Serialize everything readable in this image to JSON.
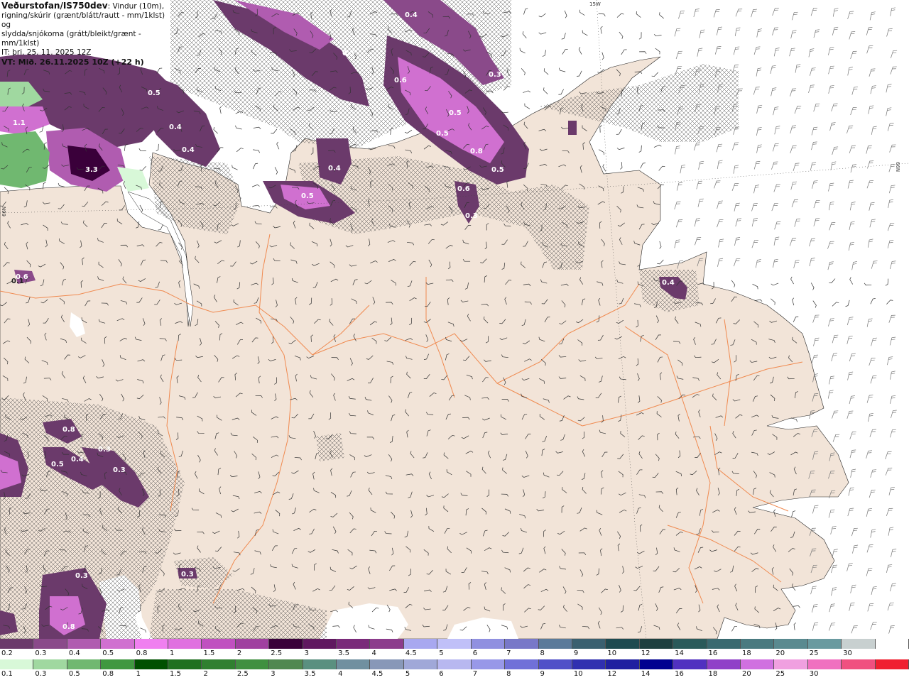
{
  "title": {
    "source": "Veðurstofan/IS750dev",
    "description_line1": ": Vindur (10m),",
    "description_line2": "rigning/skúrir (grænt/blátt/rautt - mm/1klst) og",
    "description_line3": "slydda/snjókoma (grátt/bleikt/grænt - mm/1klst)",
    "issue_time": "IT: þri. 25. 11. 2025 12Z",
    "valid_time": "VT: Mið. 26.11.2025 10Z (+22 h)"
  },
  "grid_labels": {
    "lon_15w": "15W",
    "lat_66n_left": "66N",
    "lat_66n_right": "66N"
  },
  "precip_labels": [
    {
      "text": "0.4"
    },
    {
      "text": "0.5"
    },
    {
      "text": "0.3"
    },
    {
      "text": "0.6"
    },
    {
      "text": "0.5"
    },
    {
      "text": "0.5"
    },
    {
      "text": "0.5"
    },
    {
      "text": "0.8"
    },
    {
      "text": "0.5"
    },
    {
      "text": "1.1"
    },
    {
      "text": "0.4"
    },
    {
      "text": "0.4"
    },
    {
      "text": "3.3"
    },
    {
      "text": "0.4"
    },
    {
      "text": "0.5"
    },
    {
      "text": "0.6"
    },
    {
      "text": "0.3"
    },
    {
      "text": "0.6"
    },
    {
      "text": "0.1"
    },
    {
      "text": "0.4"
    },
    {
      "text": "0.8"
    },
    {
      "text": "0.5"
    },
    {
      "text": "0.4"
    },
    {
      "text": "0.3"
    },
    {
      "text": "0.3"
    },
    {
      "text": "0.3"
    },
    {
      "text": "0.3"
    },
    {
      "text": "0.8"
    }
  ],
  "legend_snow": {
    "colors": [
      "#6b3a6b",
      "#8a4a8a",
      "#b05cb0",
      "#d070d0",
      "#f080f0",
      "#e070e0",
      "#c050c0",
      "#a040a0",
      "#3a003a",
      "#601860",
      "#7a2a7a",
      "#8c3c8c",
      "#a8a8f0",
      "#c0c0f8",
      "#9090e0",
      "#7878c8",
      "#5a7a9a",
      "#3a6070",
      "#1e4a50",
      "#1e4040",
      "#2a5a5a",
      "#3a6a70",
      "#4a7a80",
      "#5a8a90",
      "#6a9aa0",
      "#c8d0d0",
      "#ffffff"
    ],
    "labels": [
      "0.2",
      "0.3",
      "0.4",
      "0.5",
      "0.8",
      "1",
      "1.5",
      "2",
      "2.5",
      "3",
      "3.5",
      "4",
      "4.5",
      "5",
      "6",
      "7",
      "8",
      "9",
      "10",
      "12",
      "14",
      "16",
      "18",
      "20",
      "25",
      "30"
    ]
  },
  "legend_rain": {
    "colors": [
      "#d8f8d8",
      "#a0d8a0",
      "#70b870",
      "#409840",
      "#005000",
      "#207020",
      "#308030",
      "#409040",
      "#508850",
      "#5a9080",
      "#7090a0",
      "#8898b8",
      "#a0a8d8",
      "#b8b8f0",
      "#9898e8",
      "#7070d8",
      "#5050c8",
      "#3030b0",
      "#2020a0",
      "#000090",
      "#5030c0",
      "#9040c8",
      "#d070e0",
      "#f0a0e0",
      "#f070c0",
      "#f05080",
      "#f02030"
    ],
    "labels": [
      "0.1",
      "0.3",
      "0.5",
      "0.8",
      "1",
      "1.5",
      "2",
      "2.5",
      "3",
      "3.5",
      "4",
      "4.5",
      "5",
      "6",
      "7",
      "8",
      "9",
      "10",
      "12",
      "14",
      "16",
      "18",
      "20",
      "25",
      "30"
    ]
  }
}
